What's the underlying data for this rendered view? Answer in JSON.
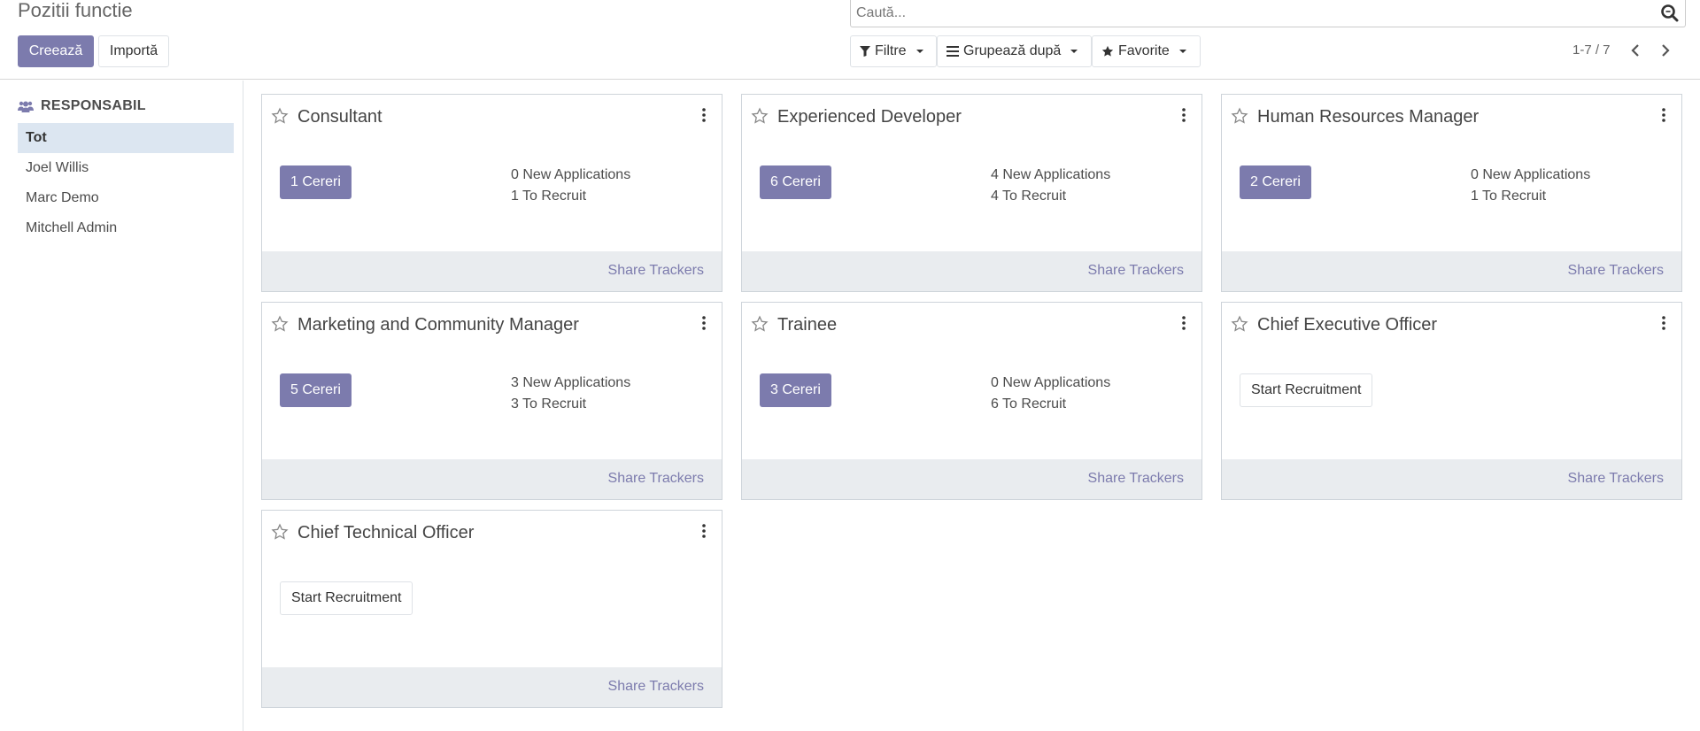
{
  "header": {
    "title": "Pozitii functie",
    "create_label": "Creează",
    "import_label": "Importă"
  },
  "search": {
    "placeholder": "Caută..."
  },
  "toolbar": {
    "filters_label": "Filtre",
    "groupby_label": "Grupează după",
    "favorites_label": "Favorite"
  },
  "pager": {
    "value": "1-7 / 7"
  },
  "sidebar": {
    "header": "RESPONSABIL",
    "items": [
      {
        "label": "Tot",
        "active": true
      },
      {
        "label": "Joel Willis",
        "active": false
      },
      {
        "label": "Marc Demo",
        "active": false
      },
      {
        "label": "Mitchell Admin",
        "active": false
      }
    ]
  },
  "cards": [
    {
      "title": "Consultant",
      "action": "1 Cereri",
      "new_apps": "0 New Applications",
      "to_recruit": "1 To Recruit",
      "footer": "Share Trackers"
    },
    {
      "title": "Experienced Developer",
      "action": "6 Cereri",
      "new_apps": "4 New Applications",
      "to_recruit": "4 To Recruit",
      "footer": "Share Trackers"
    },
    {
      "title": "Human Resources Manager",
      "action": "2 Cereri",
      "new_apps": "0 New Applications",
      "to_recruit": "1 To Recruit",
      "footer": "Share Trackers"
    },
    {
      "title": "Marketing and Community Manager",
      "action": "5 Cereri",
      "new_apps": "3 New Applications",
      "to_recruit": "3 To Recruit",
      "footer": "Share Trackers"
    },
    {
      "title": "Trainee",
      "action": "3 Cereri",
      "new_apps": "0 New Applications",
      "to_recruit": "6 To Recruit",
      "footer": "Share Trackers"
    },
    {
      "title": "Chief Executive Officer",
      "action": "Start Recruitment",
      "footer": "Share Trackers"
    },
    {
      "title": "Chief Technical Officer",
      "action": "Start Recruitment",
      "footer": "Share Trackers"
    }
  ],
  "colors": {
    "primary": "#7c7bad",
    "footer_bg": "#e9ecef",
    "active_item_bg": "#dce6f1"
  }
}
